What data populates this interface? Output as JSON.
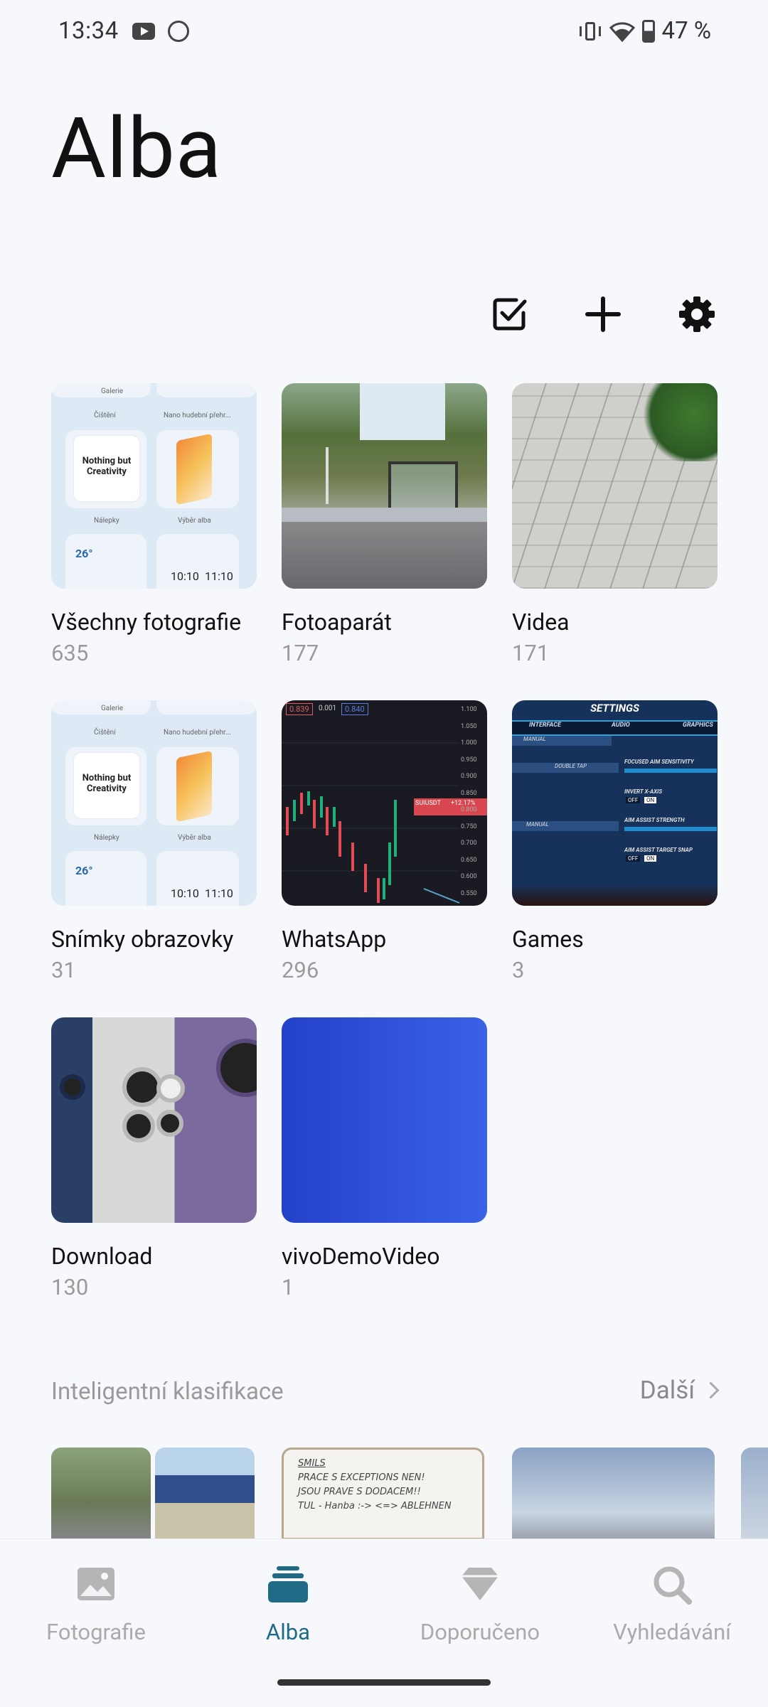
{
  "status_bar": {
    "time": "13:34",
    "battery": "47 %"
  },
  "header": {
    "title": "Alba"
  },
  "toolbar": {
    "select_icon": "checkbox-edit-icon",
    "add_icon": "plus-icon",
    "settings_icon": "gear-icon"
  },
  "albums": [
    {
      "name": "Všechny fotografie",
      "count": "635"
    },
    {
      "name": "Fotoaparát",
      "count": "177"
    },
    {
      "name": "Videa",
      "count": "171"
    },
    {
      "name": "Snímky obrazovky",
      "count": "31"
    },
    {
      "name": "WhatsApp",
      "count": "296"
    },
    {
      "name": "Games",
      "count": "3"
    },
    {
      "name": "Download",
      "count": "130"
    },
    {
      "name": "vivoDemoVideo",
      "count": "1"
    }
  ],
  "thumb_text": {
    "nothing": "Nothing but Creativity",
    "gallery_top": "Galerie",
    "cisteni": "Čištění",
    "nano": "Nano hudební přehr...",
    "nalepky": "Nálepky",
    "vyber": "Výběr alba",
    "temp": "26°",
    "clock1": "10:10",
    "clock2": "11:10",
    "wa_tag1": "0.839",
    "wa_tag2": "0.001",
    "wa_tag3": "0.840",
    "wa_pair": "SUIUSDT",
    "wa_change": "+12.17%",
    "wa_prices": [
      "1.100",
      "1.050",
      "1.000",
      "0.950",
      "0.900",
      "0.850",
      "0.800",
      "0.750",
      "0.700",
      "0.650",
      "0.600",
      "0.550"
    ],
    "games_title": "SETTINGS",
    "games_tabs": [
      "INTERFACE",
      "AUDIO",
      "GRAPHICS"
    ],
    "games_l1": "MANUAL",
    "games_l2": "DOUBLE TAP",
    "games_l3": "MANUAL",
    "games_r1": "FOCUSED AIM SENSITIVITY",
    "games_r2": "INVERT X-AXIS",
    "games_r3": "AIM ASSIST STRENGTH",
    "games_r4": "AIM ASSIST TARGET SNAP",
    "games_off": "OFF",
    "games_on": "ON",
    "note_title": "SMILS",
    "note_l1": "PRACE S EXCEPTIONS NEN!",
    "note_l2": "JSOU PRAVE S DODACEM!!",
    "note_l3": "TUL - Hanba :-> <=> ABLEHNEN"
  },
  "section": {
    "title": "Inteligentní klasifikace",
    "more": "Další"
  },
  "bottom_nav": [
    {
      "label": "Fotografie",
      "icon": "image-icon"
    },
    {
      "label": "Alba",
      "icon": "albums-stack-icon"
    },
    {
      "label": "Doporučeno",
      "icon": "diamond-icon"
    },
    {
      "label": "Vyhledávání",
      "icon": "search-icon"
    }
  ],
  "colors": {
    "accent": "#1f6b86",
    "inactive": "#aaaaaa",
    "background": "#f7f8fc"
  }
}
